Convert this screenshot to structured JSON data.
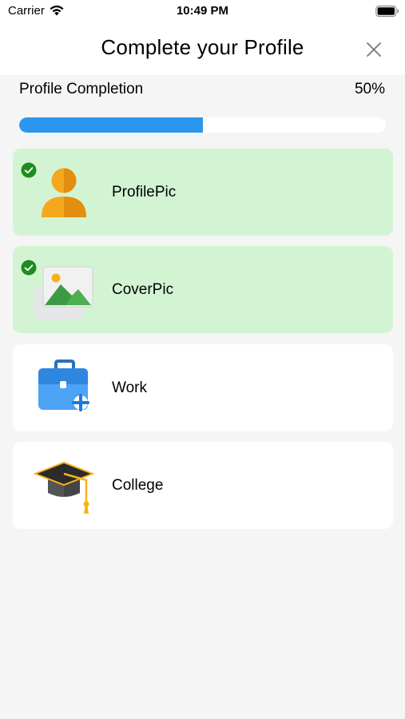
{
  "status_bar": {
    "carrier": "Carrier",
    "time": "10:49 PM",
    "icons": [
      "wifi-icon",
      "battery-icon"
    ]
  },
  "header": {
    "title": "Complete your Profile",
    "close_icon": "close-icon"
  },
  "completion": {
    "label": "Profile Completion",
    "value": "50%",
    "progress_fraction": 0.5,
    "fill_color": "#2b96ee"
  },
  "colors": {
    "completed_card_bg": "#d3f4d2",
    "pending_card_bg": "#ffffff",
    "check_badge": "#1e8c1e"
  },
  "items": [
    {
      "label": "ProfilePic",
      "icon": "user-icon",
      "completed": true
    },
    {
      "label": "CoverPic",
      "icon": "image-icon",
      "completed": true
    },
    {
      "label": "Work",
      "icon": "briefcase-add-icon",
      "completed": false
    },
    {
      "label": "College",
      "icon": "graduation-cap-icon",
      "completed": false
    }
  ]
}
